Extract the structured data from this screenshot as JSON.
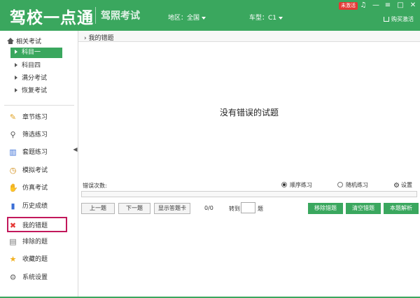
{
  "header": {
    "app_title": "驾校一点通",
    "subtitle": "驾照考试",
    "region_label": "地区：全国",
    "cartype_label": "车型：C1",
    "badge": "未激活",
    "buy_label": "购买激活"
  },
  "sidebar": {
    "section_title": "相关考试",
    "subjects": [
      "科目一",
      "科目四",
      "满分考试",
      "恢复考试"
    ],
    "menu": [
      {
        "label": "章节练习",
        "icon": "pencil-icon"
      },
      {
        "label": "筛选练习",
        "icon": "magnifier-icon"
      },
      {
        "label": "套题练习",
        "icon": "books-icon"
      },
      {
        "label": "模拟考试",
        "icon": "clock-icon"
      },
      {
        "label": "仿真考试",
        "icon": "hand-icon"
      },
      {
        "label": "历史成绩",
        "icon": "bar-chart-icon"
      },
      {
        "label": "我的错题",
        "icon": "red-x-icon"
      },
      {
        "label": "排除的题",
        "icon": "trash-icon"
      },
      {
        "label": "收藏的题",
        "icon": "star-icon"
      },
      {
        "label": "系统设置",
        "icon": "gear-icon"
      }
    ]
  },
  "main": {
    "breadcrumb": "我的错题",
    "empty_message": "没有错误的试题",
    "error_count_label": "错误次数:",
    "radio_sequential": "顺序练习",
    "radio_random": "随机练习",
    "settings_label": "设置",
    "btn_prev": "上一题",
    "btn_next": "下一题",
    "btn_answer_card": "显示答题卡",
    "counter": "0/0",
    "goto_label": "转到",
    "goto_suffix": "题",
    "btn_remove_wrong": "移除错题",
    "btn_clear_wrong": "清空错题",
    "btn_explain": "本题解析"
  },
  "colors": {
    "brand_green": "#3aa75e",
    "selected_border": "#c2185b",
    "badge_red": "#e53935"
  }
}
